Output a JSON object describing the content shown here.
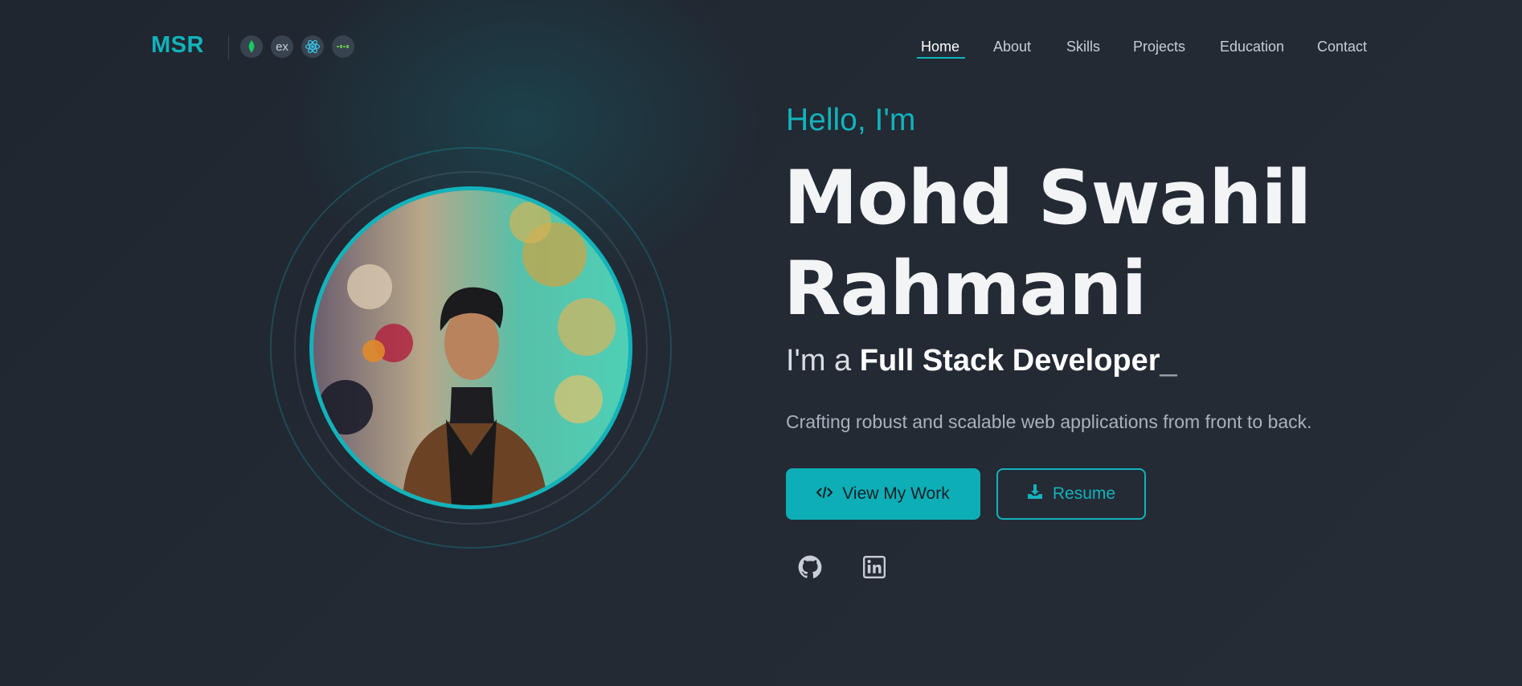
{
  "nav": {
    "logo": "MSR",
    "tech_icons": [
      "mongodb-icon",
      "express-icon",
      "react-icon",
      "nodejs-icon"
    ],
    "express_label": "ex",
    "links": [
      {
        "label": "Home",
        "active": true
      },
      {
        "label": "About",
        "active": false
      },
      {
        "label": "Skills",
        "active": false
      },
      {
        "label": "Projects",
        "active": false
      },
      {
        "label": "Education",
        "active": false
      },
      {
        "label": "Contact",
        "active": false
      }
    ]
  },
  "hero": {
    "greeting": "Hello, I'm",
    "name_line1": "Mohd Swahil",
    "name_line2": "Rahmani",
    "role_prefix": "I'm a",
    "role_title": "Full Stack Developer",
    "role_cursor": "_",
    "tagline": "Crafting robust and scalable web applications from front to back.",
    "primary_button": {
      "label": "View My Work",
      "icon": "code-icon"
    },
    "secondary_button": {
      "label": "Resume",
      "icon": "download-icon"
    },
    "socials": [
      "github-icon",
      "linkedin-icon"
    ]
  },
  "colors": {
    "accent": "#12b3bb",
    "background": "#232a34",
    "text": "#f3f4f6",
    "muted": "#aab1bb"
  }
}
